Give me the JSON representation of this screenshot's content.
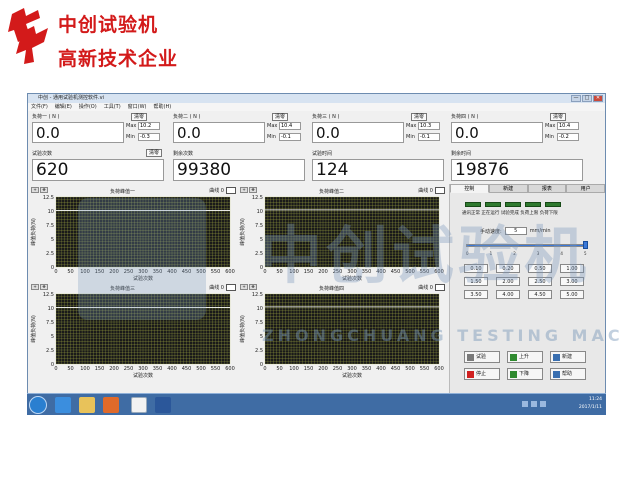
{
  "brand": {
    "line1": "中创试验机",
    "line2": "高新技术企业"
  },
  "window": {
    "title": "中创 - 通用试验机测控软件.vi",
    "buttons": [
      "—",
      "□",
      "✕"
    ]
  },
  "menu": [
    "文件(F)",
    "编辑(E)",
    "操作(O)",
    "工具(T)",
    "窗口(W)",
    "帮助(H)"
  ],
  "loads": [
    {
      "label": "负荷一 ( N )",
      "value": "0.0",
      "max": "10.2",
      "min": "-0.3",
      "clear": "清零"
    },
    {
      "label": "负荷二 ( N )",
      "value": "0.0",
      "max": "10.4",
      "min": "-0.1",
      "clear": "清零"
    },
    {
      "label": "负荷三 ( N )",
      "value": "0.0",
      "max": "10.3",
      "min": "-0.1",
      "clear": "清零"
    },
    {
      "label": "负荷四 ( N )",
      "value": "0.0",
      "max": "10.4",
      "min": "-0.2",
      "clear": "清零"
    }
  ],
  "max_label": "Max",
  "min_label": "Min",
  "counts": [
    {
      "label": "试验次数",
      "value": "620",
      "clear": "清零"
    },
    {
      "label": "剩余次数",
      "value": "99380",
      "clear": ""
    },
    {
      "label": "试验时间",
      "value": "124",
      "clear": ""
    },
    {
      "label": "剩余时间",
      "value": "19876",
      "clear": ""
    }
  ],
  "charts": [
    {
      "title": "负荷峰值一",
      "legend": "曲线 0"
    },
    {
      "title": "负荷峰值二",
      "legend": "曲线 0"
    },
    {
      "title": "负荷峰值三",
      "legend": "曲线 0"
    },
    {
      "title": "负荷峰值四",
      "legend": "曲线 0"
    }
  ],
  "chart_data": [
    {
      "type": "line",
      "title": "负荷峰值一",
      "xlabel": "试验次数",
      "ylabel": "峰值负荷(N)",
      "xlim": [
        0,
        600
      ],
      "ylim": [
        0,
        12.5
      ],
      "x_ticks": [
        0,
        50,
        100,
        150,
        200,
        250,
        300,
        350,
        400,
        450,
        500,
        550,
        600
      ],
      "y_ticks": [
        0,
        2.5,
        5,
        7.5,
        10,
        12.5
      ],
      "grid": true,
      "series": [
        {
          "x": [
            0,
            600
          ],
          "y": [
            10.1,
            10.1
          ]
        }
      ]
    },
    {
      "type": "line",
      "title": "负荷峰值二",
      "xlabel": "试验次数",
      "ylabel": "峰值负荷(N)",
      "xlim": [
        0,
        600
      ],
      "ylim": [
        0,
        12.5
      ],
      "x_ticks": [
        0,
        50,
        100,
        150,
        200,
        250,
        300,
        350,
        400,
        450,
        500,
        550,
        600
      ],
      "y_ticks": [
        0,
        2.5,
        5,
        7.5,
        10,
        12.5
      ],
      "grid": true,
      "series": [
        {
          "x": [
            0,
            600
          ],
          "y": [
            10.2,
            10.2
          ]
        }
      ]
    },
    {
      "type": "line",
      "title": "负荷峰值三",
      "xlabel": "试验次数",
      "ylabel": "峰值负荷(N)",
      "xlim": [
        0,
        600
      ],
      "ylim": [
        0,
        12.5
      ],
      "x_ticks": [
        0,
        50,
        100,
        150,
        200,
        250,
        300,
        350,
        400,
        450,
        500,
        550,
        600
      ],
      "y_ticks": [
        0,
        2.5,
        5,
        7.5,
        10,
        12.5
      ],
      "grid": true,
      "series": [
        {
          "x": [
            0,
            600
          ],
          "y": [
            10.1,
            10.1
          ]
        }
      ]
    },
    {
      "type": "line",
      "title": "负荷峰值四",
      "xlabel": "试验次数",
      "ylabel": "峰值负荷(N)",
      "xlim": [
        0,
        600
      ],
      "ylim": [
        0,
        12.5
      ],
      "x_ticks": [
        0,
        50,
        100,
        150,
        200,
        250,
        300,
        350,
        400,
        450,
        500,
        550,
        600
      ],
      "y_ticks": [
        0,
        2.5,
        5,
        7.5,
        10,
        12.5
      ],
      "grid": true,
      "series": [
        {
          "x": [
            0,
            600
          ],
          "y": [
            10.2,
            10.2
          ]
        }
      ]
    }
  ],
  "control": {
    "tabs": [
      "控制",
      "新建",
      "报表",
      "用户"
    ],
    "status_text": "通讯正常 正在运行 试验完成 负荷上限 负荷下限",
    "speed_label": "手动速度:",
    "speed_value": "5",
    "speed_unit": "mm/min",
    "slider_value": 5,
    "slider_max": 5,
    "slider_ticks": [
      "0",
      "1",
      "2",
      "3",
      "4",
      "5"
    ],
    "speed_presets": [
      "0.10",
      "0.20",
      "0.50",
      "1.00",
      "1.50",
      "2.00",
      "2.50",
      "3.00",
      "3.50",
      "4.00",
      "4.50",
      "5.00"
    ],
    "actions": [
      {
        "label": "试验",
        "icon": "play-icon",
        "color": "#7a7a7a"
      },
      {
        "label": "上升",
        "icon": "up-arrow-icon",
        "color": "#2f8a2f"
      },
      {
        "label": "新建",
        "icon": "new-icon",
        "color": "#3a6fb0"
      },
      {
        "label": "停止",
        "icon": "stop-icon",
        "color": "#d02020"
      },
      {
        "label": "下降",
        "icon": "down-arrow-icon",
        "color": "#2f8a2f"
      },
      {
        "label": "帮助",
        "icon": "help-icon",
        "color": "#3a6fb0"
      }
    ]
  },
  "watermark": {
    "main": "中创试验机",
    "sub": "ZHONGCHUANG TESTING MACHINE"
  },
  "taskbar": {
    "time": "11:24",
    "date": "2017/1/11"
  },
  "colors": {
    "brand_red": "#d31a1a",
    "plot_bg": "#1a1a1a",
    "grid": "#b8c24a",
    "trace": "#ffffff"
  }
}
